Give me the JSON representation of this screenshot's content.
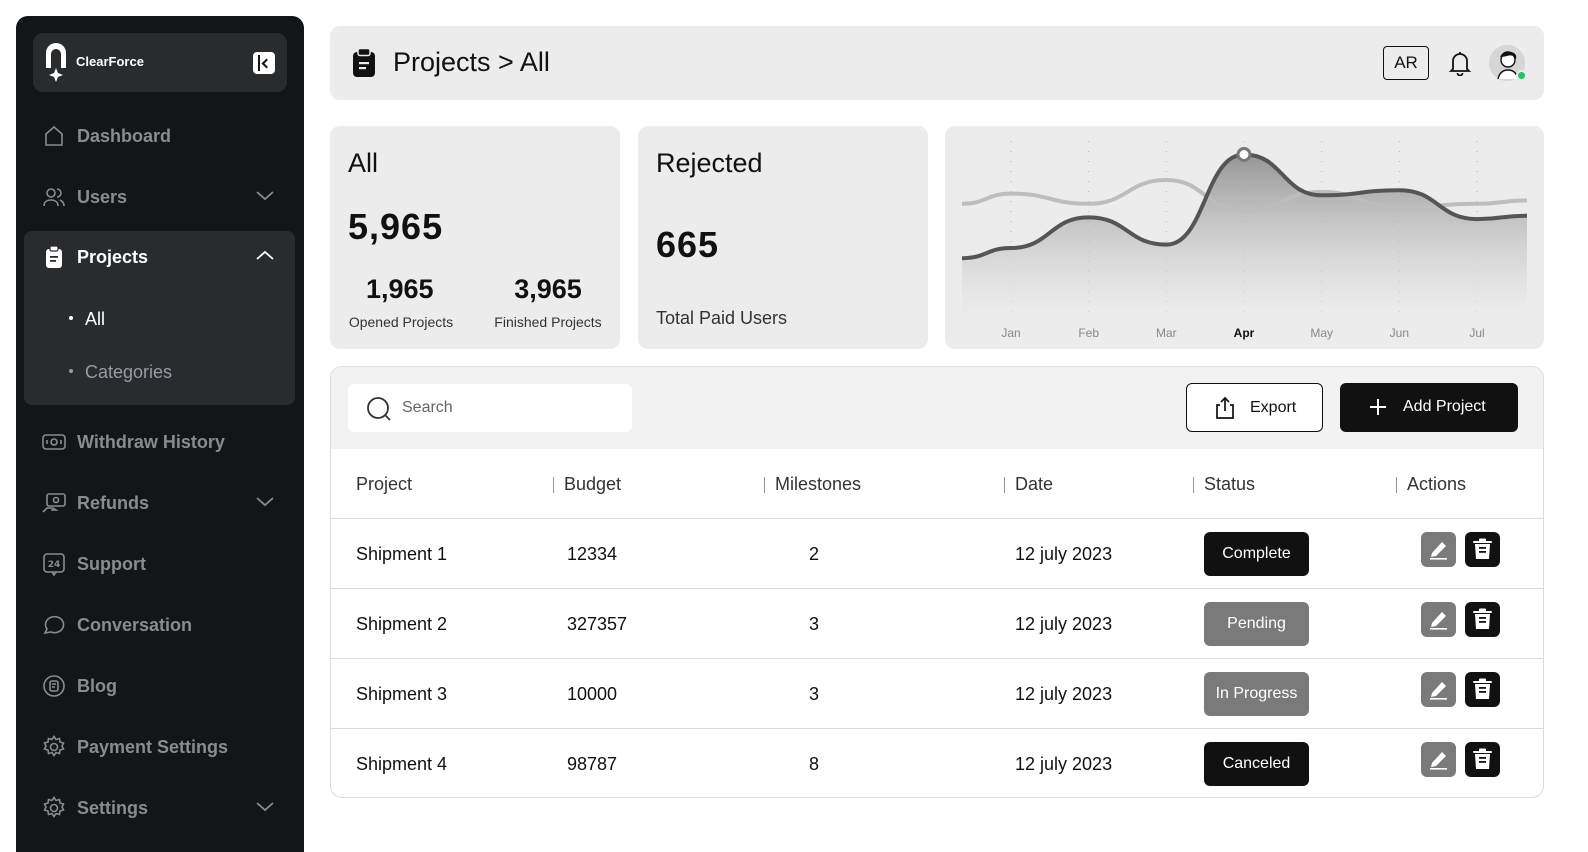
{
  "brand": {
    "name": "ClearForce"
  },
  "sidebar": {
    "items": [
      {
        "label": "Dashboard",
        "icon": "home-icon"
      },
      {
        "label": "Users",
        "icon": "users-icon",
        "expandable": true
      },
      {
        "label": "Projects",
        "icon": "clipboard-icon",
        "expandable": true,
        "expanded": true,
        "children": [
          {
            "label": "All",
            "active": true
          },
          {
            "label": "Categories",
            "active": false
          }
        ]
      },
      {
        "label": "Withdraw History",
        "icon": "money-icon"
      },
      {
        "label": "Refunds",
        "icon": "refund-icon",
        "expandable": true
      },
      {
        "label": "Support",
        "icon": "support-24-icon"
      },
      {
        "label": "Conversation",
        "icon": "chat-icon"
      },
      {
        "label": "Blog",
        "icon": "blog-icon"
      },
      {
        "label": "Payment Settings",
        "icon": "gear-icon"
      },
      {
        "label": "Settings",
        "icon": "gear-icon",
        "expandable": true
      }
    ]
  },
  "header": {
    "breadcrumb": "Projects > All",
    "lang": "AR",
    "online_color": "#22c55e"
  },
  "stats": {
    "all": {
      "title": "All",
      "total": "5,965",
      "opened_value": "1,965",
      "opened_label": "Opened Projects",
      "finished_value": "3,965",
      "finished_label": "Finished Projects"
    },
    "rejected": {
      "title": "Rejected",
      "value": "665",
      "label": "Total Paid Users"
    }
  },
  "chart_data": {
    "type": "area",
    "categories": [
      "Jan",
      "Feb",
      "Mar",
      "Apr",
      "May",
      "Jun",
      "Jul"
    ],
    "highlighted_category": "Apr",
    "ylim": [
      0,
      100
    ],
    "grid": "vertical-dotted",
    "series": [
      {
        "values": [
          40,
          58,
          42,
          95,
          71,
          74,
          57
        ],
        "style": "dark-line-with-gradient-fill"
      },
      {
        "values": [
          72,
          66,
          80,
          62,
          73,
          64,
          66
        ],
        "style": "light-line"
      }
    ],
    "marker": {
      "category": "Apr",
      "value": 95
    }
  },
  "toolbar": {
    "search_placeholder": "Search",
    "export_label": "Export",
    "add_label": "Add Project"
  },
  "table": {
    "columns": [
      "Project",
      "Budget",
      "Milestones",
      "Date",
      "Status",
      "Actions"
    ],
    "rows": [
      {
        "project": "Shipment 1",
        "budget": "12334",
        "milestones": "2",
        "date": "12 july 2023",
        "status": "Complete",
        "tone": "dark"
      },
      {
        "project": "Shipment 2",
        "budget": "327357",
        "milestones": "3",
        "date": "12 july 2023",
        "status": "Pending",
        "tone": "gray"
      },
      {
        "project": "Shipment 3",
        "budget": "10000",
        "milestones": "3",
        "date": "12 july 2023",
        "status": "In Progress",
        "tone": "gray"
      },
      {
        "project": "Shipment 4",
        "budget": "98787",
        "milestones": "8",
        "date": "12 july 2023",
        "status": "Canceled",
        "tone": "dark"
      }
    ]
  }
}
